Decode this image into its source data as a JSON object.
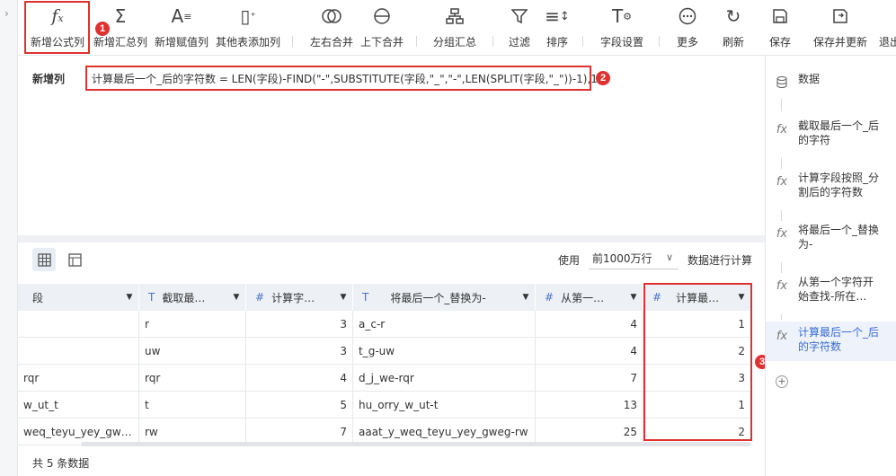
{
  "toolbar": {
    "items": [
      {
        "label": "新增公式列",
        "icon": "fx-icon"
      },
      {
        "label": "新增汇总列",
        "icon": "sigma-icon"
      },
      {
        "label": "新增赋值列",
        "icon": "assign-icon"
      },
      {
        "label": "其他表添加列",
        "icon": "add-column-icon"
      },
      {
        "label": "左右合并",
        "icon": "merge-lr-icon"
      },
      {
        "label": "上下合并",
        "icon": "merge-ud-icon"
      },
      {
        "label": "分组汇总",
        "icon": "group-icon"
      },
      {
        "label": "过滤",
        "icon": "filter-icon"
      },
      {
        "label": "排序",
        "icon": "sort-icon"
      },
      {
        "label": "字段设置",
        "icon": "field-settings-icon"
      },
      {
        "label": "更多",
        "icon": "more-icon"
      },
      {
        "label": "刷新",
        "icon": "refresh-icon"
      },
      {
        "label": "保存",
        "icon": "save-icon"
      },
      {
        "label": "保存并更新",
        "icon": "save-update-icon"
      },
      {
        "label": "退出",
        "icon": "exit-icon"
      }
    ]
  },
  "formula": {
    "label": "新增列",
    "text": "计算最后一个_后的字符数 = LEN(字段)-FIND(\"-\",SUBSTITUTE(字段,\"_\",\"-\",LEN(SPLIT(字段,\"_\"))-1),1)"
  },
  "badges": {
    "one": "1",
    "two": "2",
    "three": "3"
  },
  "table_controls": {
    "use_label": "使用",
    "select_value": "前1000万行",
    "suffix_label": "数据进行计算"
  },
  "table": {
    "headers": [
      {
        "type": "T",
        "name": "段"
      },
      {
        "type": "T",
        "name": "截取最…"
      },
      {
        "type": "#",
        "name": "计算字…"
      },
      {
        "type": "T",
        "name": "将最后一个_替换为-"
      },
      {
        "type": "#",
        "name": "从第一…"
      },
      {
        "type": "#",
        "name": "计算最…"
      }
    ],
    "rows": [
      [
        "",
        "r",
        "3",
        "a_c-r",
        "4",
        "1"
      ],
      [
        "",
        "uw",
        "3",
        "t_g-uw",
        "4",
        "2"
      ],
      [
        "rqr",
        "rqr",
        "4",
        "d_j_we-rqr",
        "7",
        "3"
      ],
      [
        "w_ut_t",
        "t",
        "5",
        "hu_orry_w_ut-t",
        "13",
        "1"
      ],
      [
        "weq_teyu_yey_gw…",
        "rw",
        "7",
        "aaat_y_weq_teyu_yey_gweg-rw",
        "25",
        "2"
      ]
    ],
    "footer": "共 5 条数据"
  },
  "steps": [
    {
      "label": "数据",
      "icon": "database-icon"
    },
    {
      "label": "截取最后一个_后的字符",
      "icon": "fx-icon"
    },
    {
      "label": "计算字段按照_分割后的字符数",
      "icon": "fx-icon"
    },
    {
      "label": "将最后一个_替换为-",
      "icon": "fx-icon"
    },
    {
      "label": "从第一个字符开始查找-所在…",
      "icon": "fx-icon"
    },
    {
      "label": "计算最后一个_后的字符数",
      "icon": "fx-icon",
      "active": true
    }
  ],
  "colors": {
    "accent": "#3b6cd4",
    "highlight": "#e03131"
  }
}
